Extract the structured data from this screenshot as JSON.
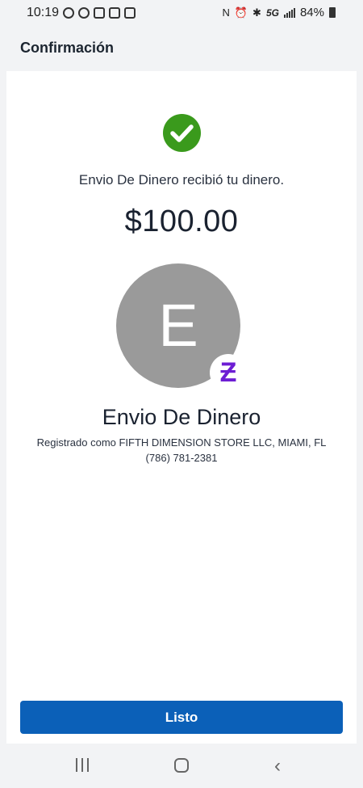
{
  "status_bar": {
    "time": "10:19",
    "network": "5G",
    "battery": "84%"
  },
  "header": {
    "title": "Confirmación"
  },
  "confirmation": {
    "message": "Envio De Dinero recibió tu dinero.",
    "amount": "$100.00"
  },
  "recipient": {
    "initial": "E",
    "name": "Envio De Dinero",
    "registered": "Registrado como FIFTH DIMENSION STORE LLC, MIAMI, FL",
    "phone": "(786) 781-2381"
  },
  "badge": {
    "glyph": "Ƶ"
  },
  "actions": {
    "done_label": "Listo"
  },
  "colors": {
    "success": "#3a9a1c",
    "primary": "#0b60b8",
    "zelle": "#6d1ed4",
    "avatar": "#9a9a9a"
  },
  "icons": [
    "check-circle-icon",
    "zelle-icon",
    "nav-recents-icon",
    "nav-home-icon",
    "nav-back-icon"
  ]
}
